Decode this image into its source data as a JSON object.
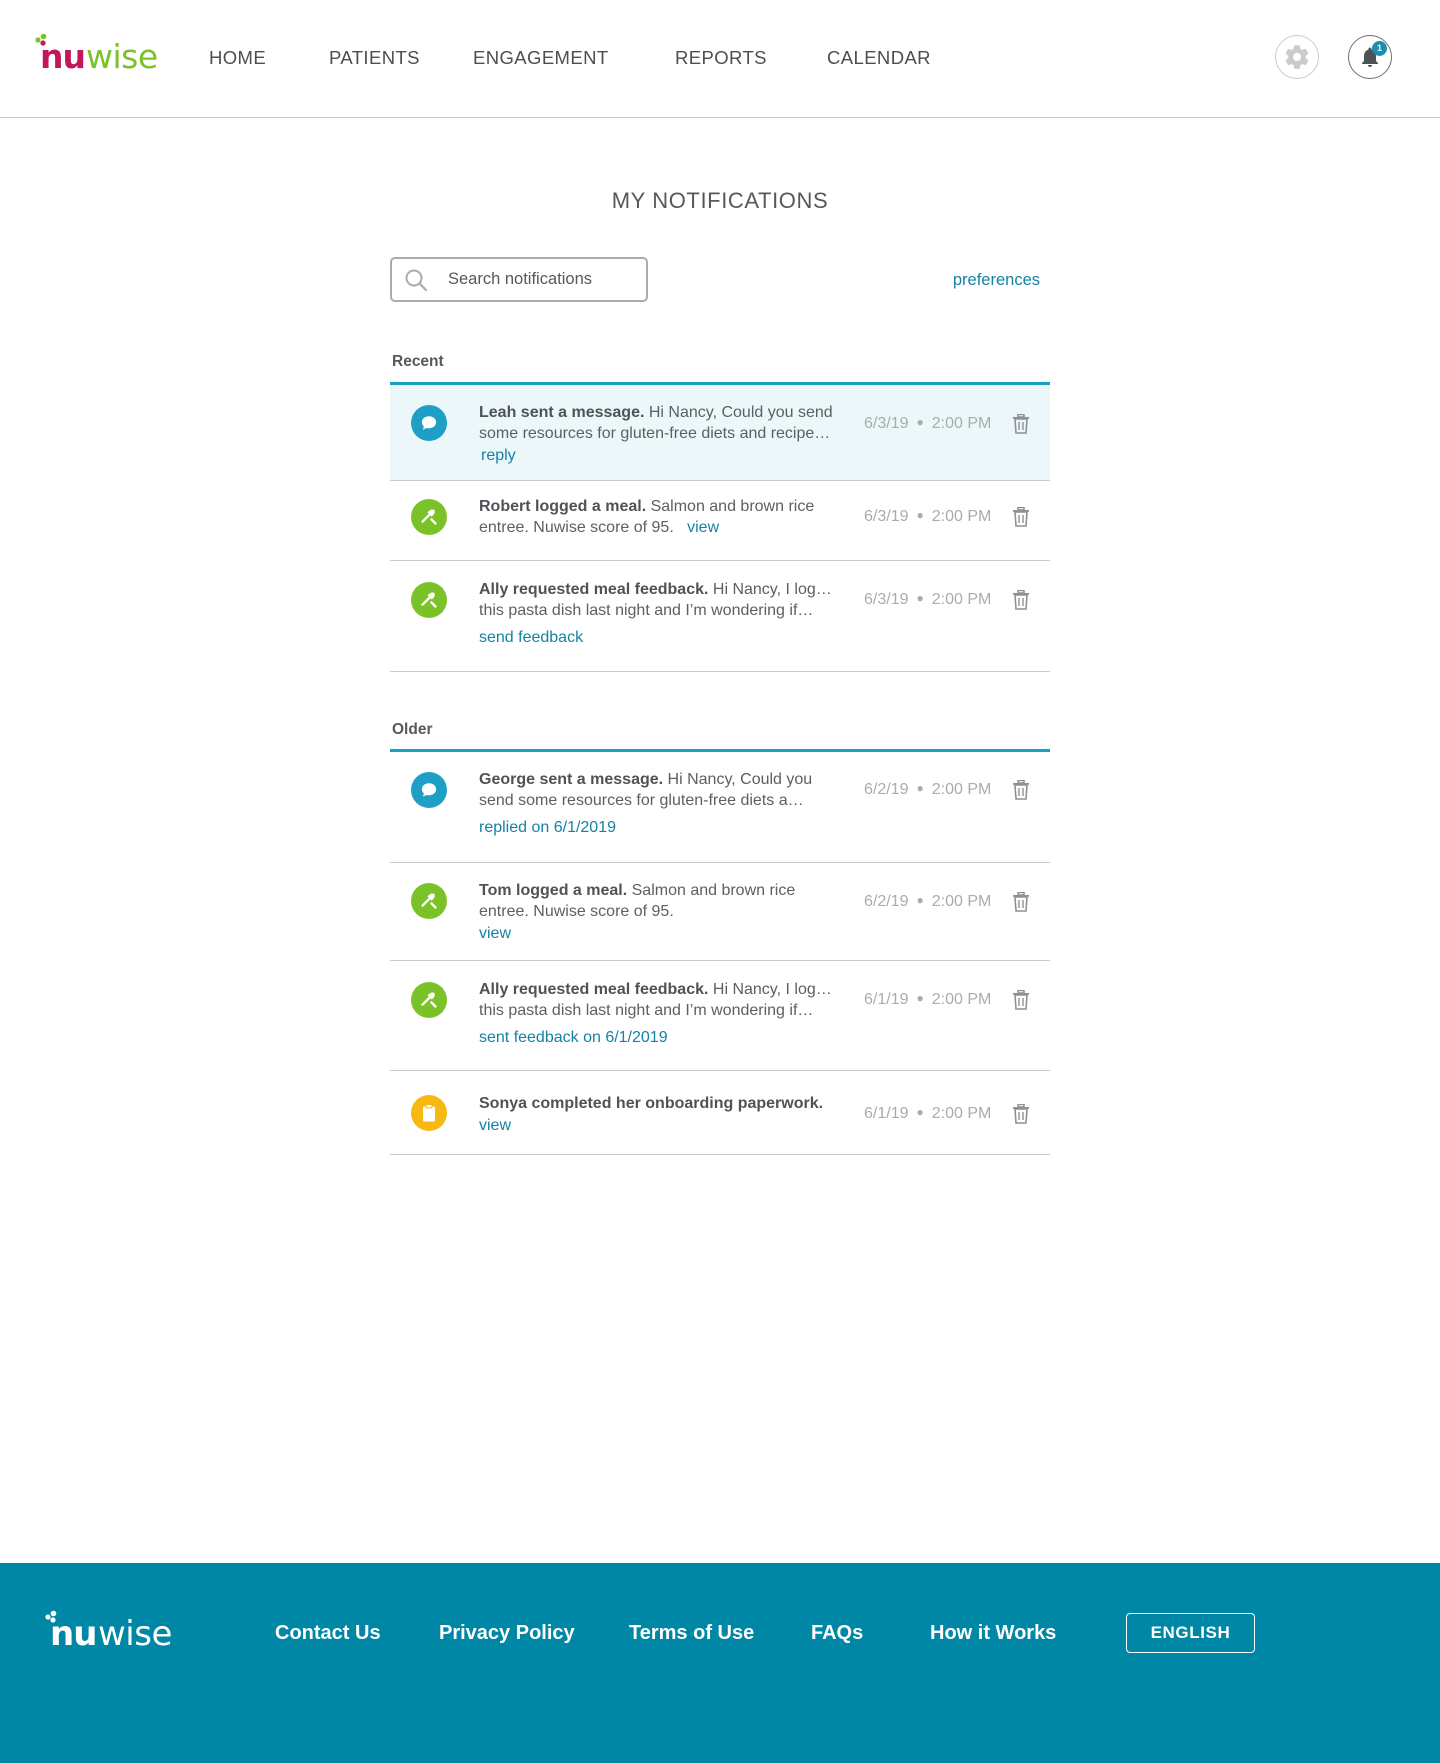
{
  "header": {
    "logo_text": "nuwise",
    "nav": [
      "HOME",
      "PATIENTS",
      "ENGAGEMENT",
      "REPORTS",
      "CALENDAR"
    ],
    "notification_count": "1"
  },
  "main": {
    "title": "MY NOTIFICATIONS",
    "search_placeholder": "Search notifications",
    "preferences_label": "preferences",
    "recent": {
      "label": "Recent",
      "items": [
        {
          "icon": "chat-bubble-icon",
          "bold": "Leah sent a message.",
          "text1": " Hi Nancy, Could you send",
          "text2": "some resources for gluten-free diets and recipe…",
          "action": "reply",
          "date": "6/3/19",
          "time": "2:00 PM"
        },
        {
          "icon": "utensils-icon",
          "bold": "Robert logged a meal.",
          "text1": " Salmon and brown rice",
          "text2": "entree. Nuwise score of 95.",
          "action": "view",
          "date": "6/3/19",
          "time": "2:00 PM"
        },
        {
          "icon": "utensils-icon",
          "bold": "Ally requested meal feedback.",
          "text1": " Hi Nancy, I logged",
          "text2": "this pasta dish last night and I’m wondering if…",
          "action": "send feedback",
          "date": "6/3/19",
          "time": "2:00 PM"
        }
      ]
    },
    "older": {
      "label": "Older",
      "items": [
        {
          "icon": "chat-bubble-icon",
          "bold": "George sent a message.",
          "text1": " Hi Nancy, Could you",
          "text2": "send some resources for gluten-free diets a…",
          "action": "replied on 6/1/2019",
          "date": "6/2/19",
          "time": "2:00 PM"
        },
        {
          "icon": "utensils-icon",
          "bold": "Tom logged a meal.",
          "text1": " Salmon and brown rice",
          "text2": "entree. Nuwise score of 95.",
          "action": "view",
          "date": "6/2/19",
          "time": "2:00 PM"
        },
        {
          "icon": "utensils-icon",
          "bold": "Ally requested meal feedback.",
          "text1": " Hi Nancy, I logged",
          "text2": "this pasta dish last night and I’m wondering if…",
          "action": "sent feedback on 6/1/2019",
          "date": "6/1/19",
          "time": "2:00 PM"
        },
        {
          "icon": "clipboard-icon",
          "bold": "Sonya completed her onboarding paperwork.",
          "action": "view",
          "date": "6/1/19",
          "time": "2:00 PM"
        }
      ]
    }
  },
  "footer": {
    "links": [
      "Contact Us",
      "Privacy Policy",
      "Terms of Use",
      "FAQs",
      "How it Works"
    ],
    "language": "ENGLISH"
  },
  "colors": {
    "brand_magenta": "#c2185b",
    "brand_green": "#7bc128",
    "accent_blue": "#1b9fc4",
    "link_blue": "#1582a5",
    "footer_bg": "#0087a5",
    "unread_bg": "#ecf7f9",
    "icon_yellow": "#f7b911"
  }
}
